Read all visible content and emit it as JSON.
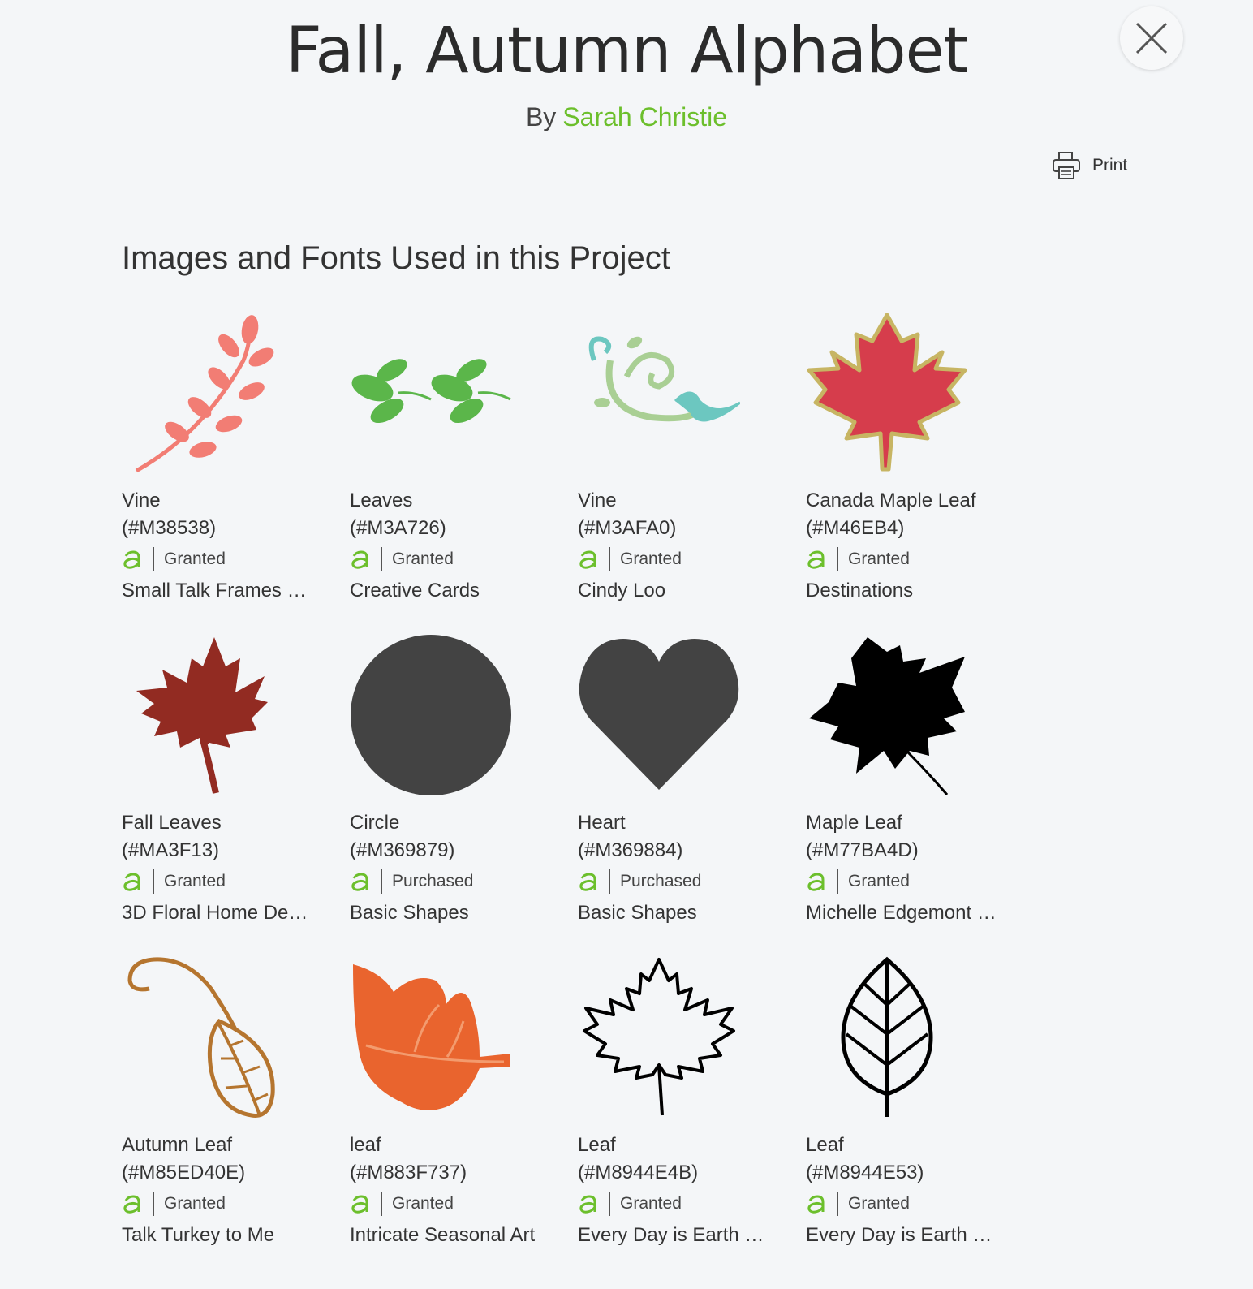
{
  "header": {
    "title": "Fall, Autumn Alphabet",
    "by_label": "By",
    "author": "Sarah Christie",
    "print_label": "Print"
  },
  "section": {
    "title": "Images and Fonts Used in this Project"
  },
  "colors": {
    "accent_green": "#6cbf2c",
    "background": "#f4f6f8"
  },
  "items": [
    {
      "name": "Vine",
      "code": "(#M38538)",
      "status": "Granted",
      "cartridge": "Small Talk Frames …",
      "icon": "pink-branch-icon"
    },
    {
      "name": "Leaves",
      "code": "(#M3A726)",
      "status": "Granted",
      "cartridge": "Creative Cards",
      "icon": "green-leaves-icon"
    },
    {
      "name": "Vine",
      "code": "(#M3AFA0)",
      "status": "Granted",
      "cartridge": "Cindy Loo",
      "icon": "swirl-vine-icon"
    },
    {
      "name": "Canada Maple Leaf",
      "code": "(#M46EB4)",
      "status": "Granted",
      "cartridge": "Destinations",
      "icon": "red-maple-leaf-icon"
    },
    {
      "name": "Fall Leaves",
      "code": "(#MA3F13)",
      "status": "Granted",
      "cartridge": "3D Floral Home De…",
      "icon": "dark-red-maple-leaf-icon"
    },
    {
      "name": "Circle",
      "code": "(#M369879)",
      "status": "Purchased",
      "cartridge": "Basic Shapes",
      "icon": "circle-icon"
    },
    {
      "name": "Heart",
      "code": "(#M369884)",
      "status": "Purchased",
      "cartridge": "Basic Shapes",
      "icon": "heart-icon"
    },
    {
      "name": "Maple Leaf",
      "code": "(#M77BA4D)",
      "status": "Granted",
      "cartridge": "Michelle Edgemont …",
      "icon": "black-maple-leaf-icon"
    },
    {
      "name": "Autumn Leaf",
      "code": "(#M85ED40E)",
      "status": "Granted",
      "cartridge": "Talk Turkey to Me",
      "icon": "brown-leaf-outline-icon"
    },
    {
      "name": "leaf",
      "code": "(#M883F737)",
      "status": "Granted",
      "cartridge": "Intricate Seasonal Art",
      "icon": "orange-leaf-icon"
    },
    {
      "name": "Leaf",
      "code": "(#M8944E4B)",
      "status": "Granted",
      "cartridge": "Every Day is Earth …",
      "icon": "maple-leaf-outline-icon"
    },
    {
      "name": "Leaf",
      "code": "(#M8944E53)",
      "status": "Granted",
      "cartridge": "Every Day is Earth …",
      "icon": "leaf-veins-outline-icon"
    }
  ]
}
